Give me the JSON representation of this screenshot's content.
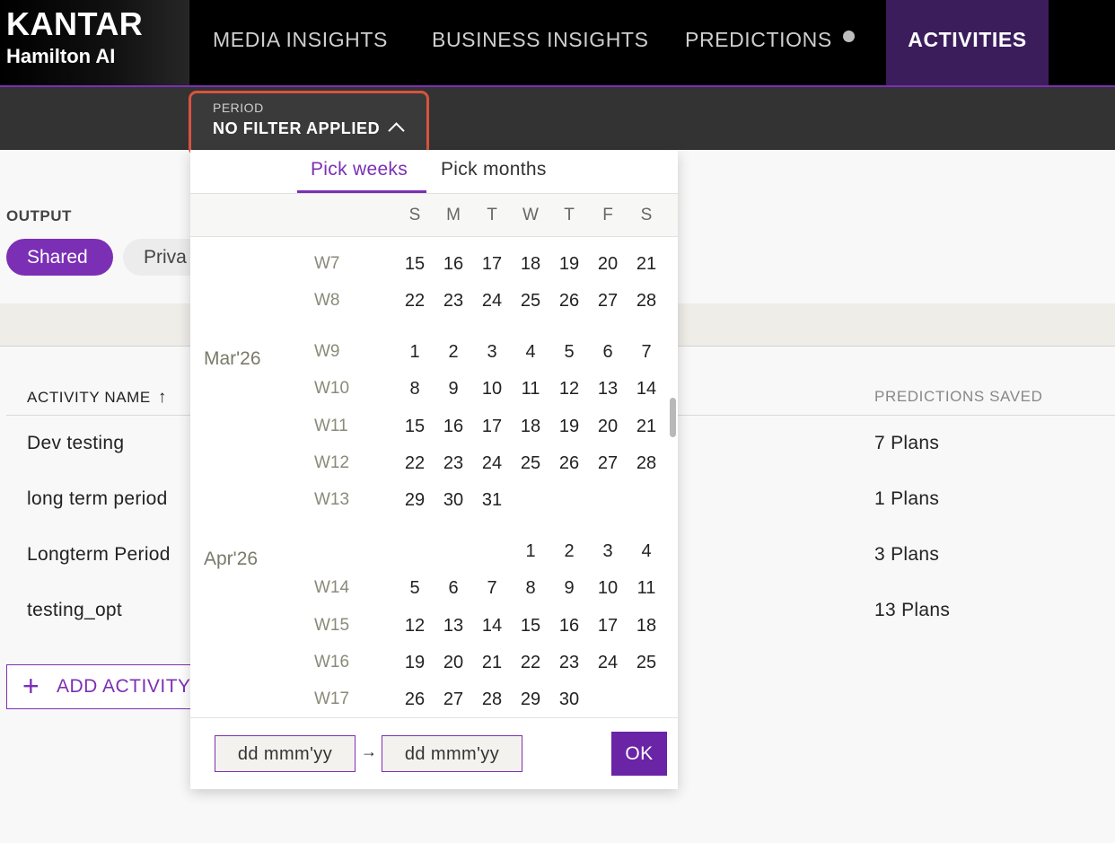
{
  "brand": {
    "name": "KANTAR",
    "sub": "Hamilton AI"
  },
  "nav": [
    {
      "label": "MEDIA INSIGHTS"
    },
    {
      "label": "BUSINESS INSIGHTS"
    },
    {
      "label": "PREDICTIONS"
    },
    {
      "label": "ACTIVITIES"
    }
  ],
  "period": {
    "label": "PERIOD",
    "value": "NO FILTER APPLIED"
  },
  "output": {
    "label": "OUTPUT",
    "shared": "Shared",
    "private": "Priva"
  },
  "table": {
    "col_name": "ACTIVITY NAME",
    "col_predictions": "PREDICTIONS SAVED",
    "rows": [
      {
        "name": "Dev testing",
        "plans": "7 Plans"
      },
      {
        "name": "long term period",
        "plans": "1 Plans"
      },
      {
        "name": "Longterm Period",
        "plans": "3 Plans"
      },
      {
        "name": "testing_opt",
        "plans": "13 Plans"
      }
    ]
  },
  "add_activity": "ADD ACTIVITY",
  "calendar": {
    "tabs": {
      "weeks": "Pick weeks",
      "months": "Pick months"
    },
    "weekdays": [
      "S",
      "M",
      "T",
      "W",
      "T",
      "F",
      "S"
    ],
    "months": [
      "Mar'26",
      "Apr'26"
    ],
    "weeks": [
      {
        "label": "W7",
        "days": [
          "15",
          "16",
          "17",
          "18",
          "19",
          "20",
          "21"
        ]
      },
      {
        "label": "W8",
        "days": [
          "22",
          "23",
          "24",
          "25",
          "26",
          "27",
          "28"
        ]
      },
      {
        "label": "W9",
        "days": [
          "1",
          "2",
          "3",
          "4",
          "5",
          "6",
          "7"
        ]
      },
      {
        "label": "W10",
        "days": [
          "8",
          "9",
          "10",
          "11",
          "12",
          "13",
          "14"
        ]
      },
      {
        "label": "W11",
        "days": [
          "15",
          "16",
          "17",
          "18",
          "19",
          "20",
          "21"
        ]
      },
      {
        "label": "W12",
        "days": [
          "22",
          "23",
          "24",
          "25",
          "26",
          "27",
          "28"
        ]
      },
      {
        "label": "W13",
        "days": [
          "29",
          "30",
          "31",
          "",
          "",
          "",
          ""
        ]
      },
      {
        "label": "",
        "days": [
          "",
          "",
          "",
          "1",
          "2",
          "3",
          "4"
        ]
      },
      {
        "label": "W14",
        "days": [
          "5",
          "6",
          "7",
          "8",
          "9",
          "10",
          "11"
        ]
      },
      {
        "label": "W15",
        "days": [
          "12",
          "13",
          "14",
          "15",
          "16",
          "17",
          "18"
        ]
      },
      {
        "label": "W16",
        "days": [
          "19",
          "20",
          "21",
          "22",
          "23",
          "24",
          "25"
        ]
      },
      {
        "label": "W17",
        "days": [
          "26",
          "27",
          "28",
          "29",
          "30",
          "",
          ""
        ]
      }
    ],
    "start_placeholder": "dd mmm'yy",
    "end_placeholder": "dd mmm'yy",
    "arrow": "→",
    "ok": "OK"
  }
}
